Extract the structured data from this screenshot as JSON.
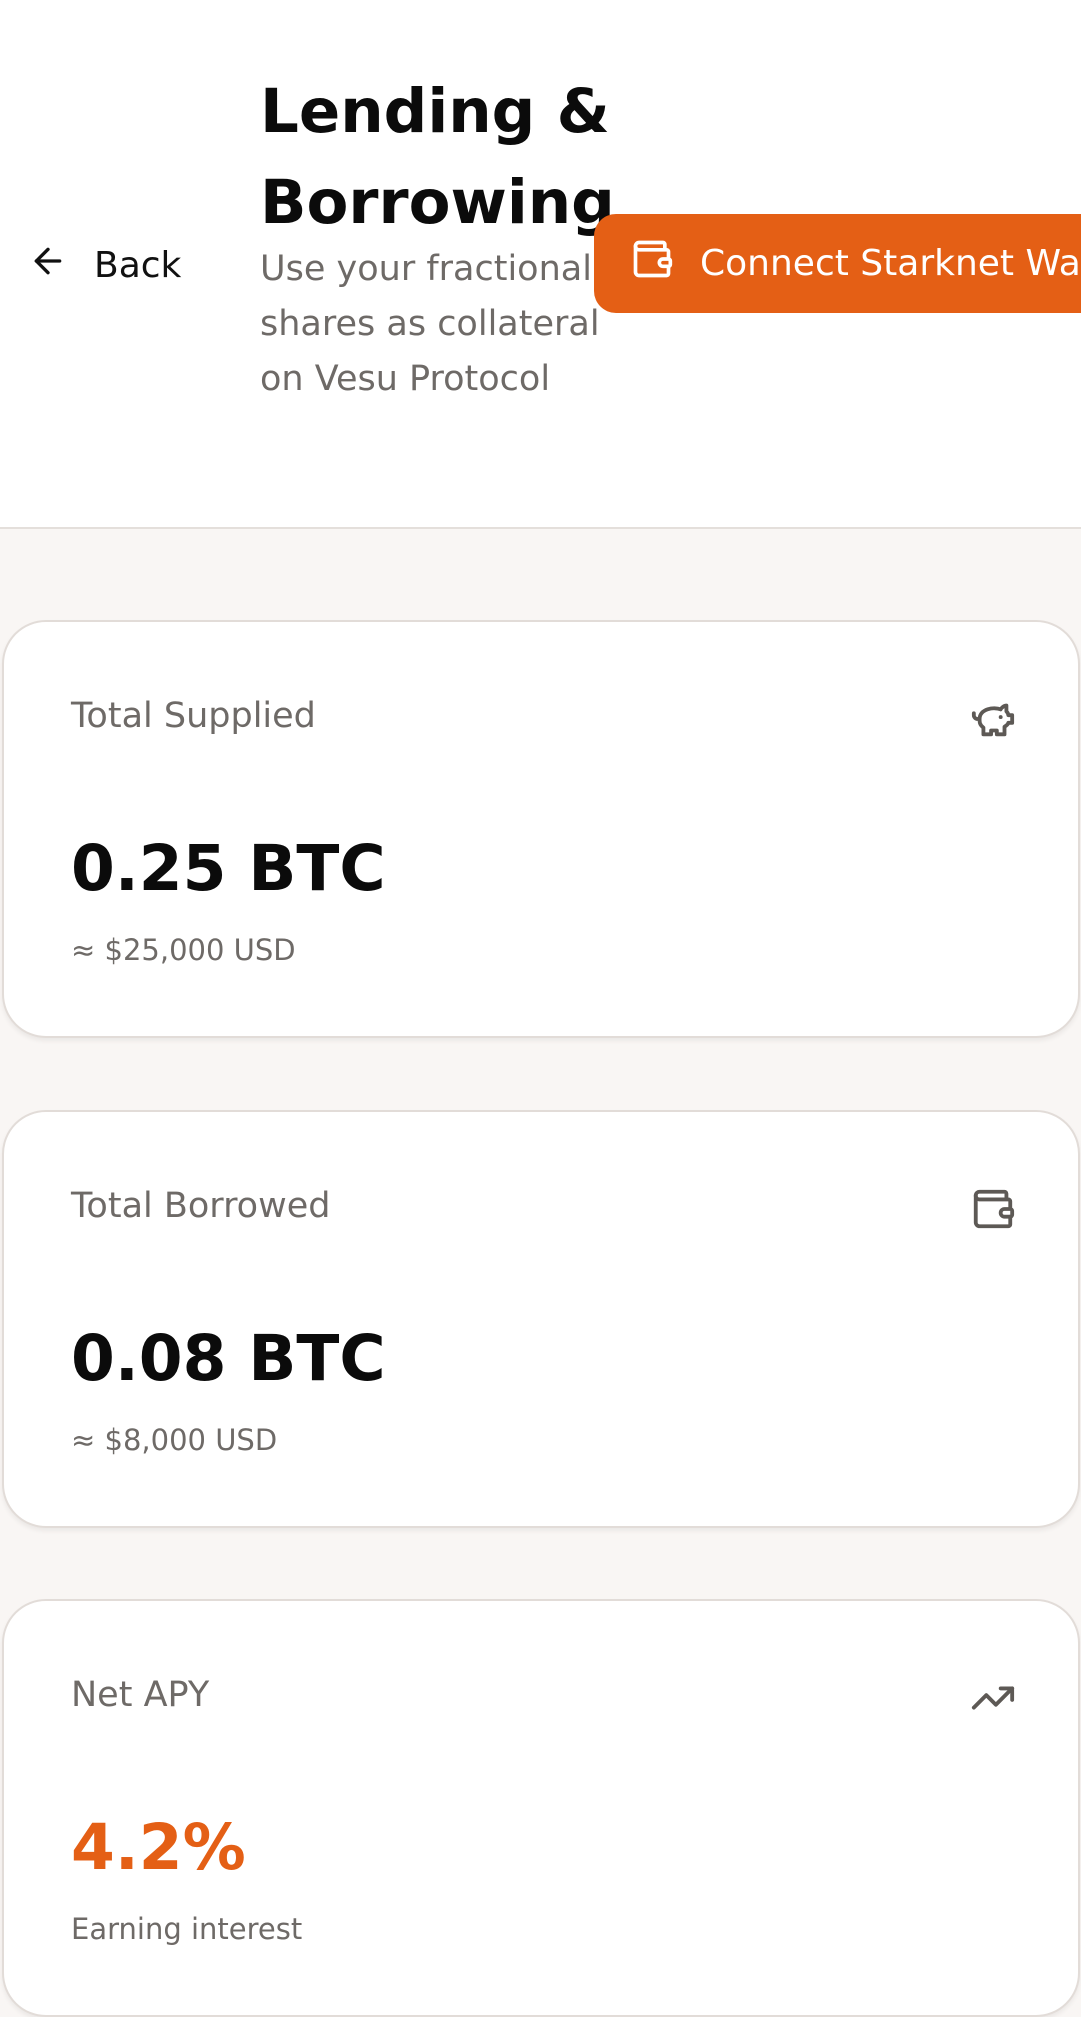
{
  "header": {
    "back_label": "Back",
    "title": "Lending & Borrowing",
    "subtitle": "Use your fractional shares as collateral on Vesu Protocol",
    "connect_label": "Connect Starknet Wallet"
  },
  "cards": [
    {
      "label": "Total Supplied",
      "icon": "piggy-bank-icon",
      "value": "0.25 BTC",
      "sub": "≈ $25,000 USD"
    },
    {
      "label": "Total Borrowed",
      "icon": "wallet-icon",
      "value": "0.08 BTC",
      "sub": "≈ $8,000 USD"
    },
    {
      "label": "Net APY",
      "icon": "trending-up-icon",
      "value": "4.2%",
      "sub": "Earning interest"
    }
  ],
  "colors": {
    "accent": "#e45f15",
    "background": "#f9f6f4",
    "muted_text": "#6e6a67"
  }
}
